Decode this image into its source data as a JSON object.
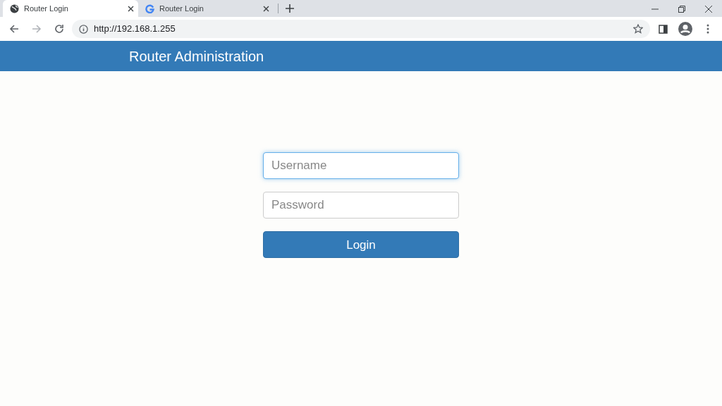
{
  "tabs": [
    {
      "title": "Router Login",
      "selected": true
    },
    {
      "title": "Router Login",
      "selected": false
    }
  ],
  "address": "http://192.168.1.255",
  "header": {
    "title": "Router Administration"
  },
  "fields": [
    {
      "placeholder": "Username",
      "focused": true
    },
    {
      "placeholder": "Password",
      "focused": false
    }
  ],
  "button": "Login"
}
